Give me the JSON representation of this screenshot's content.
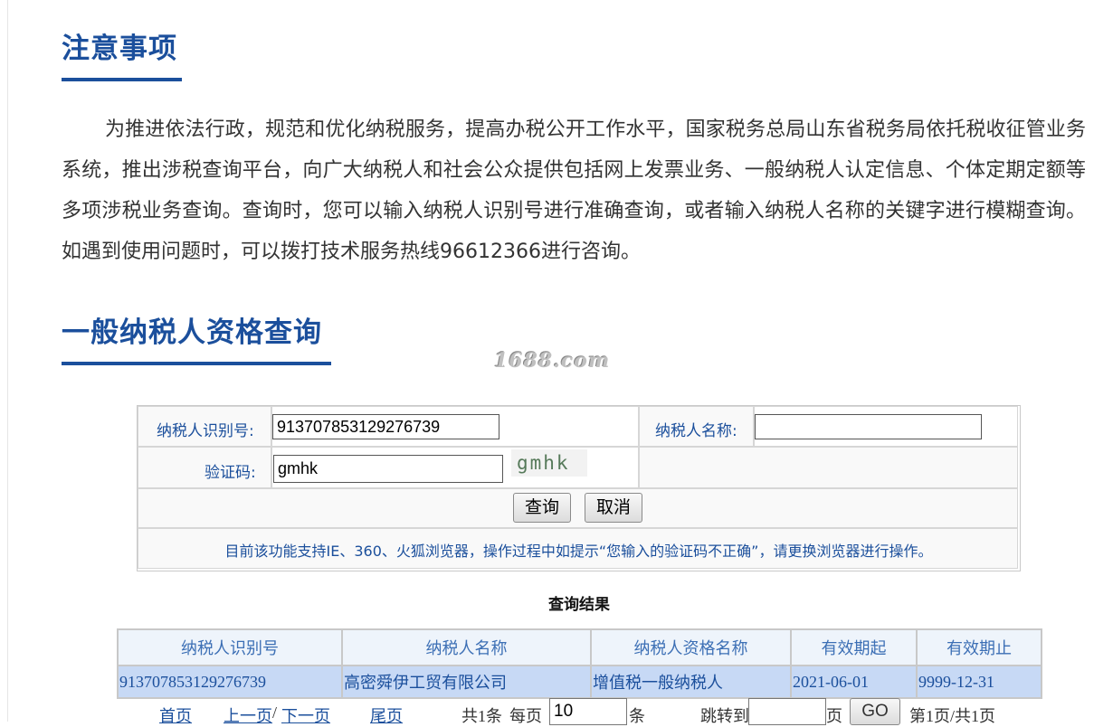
{
  "notice": {
    "title": "注意事项",
    "body": "为推进依法行政，规范和优化纳税服务，提高办税公开工作水平，国家税务总局山东省税务局依托税收征管业务系统，推出涉税查询平台，向广大纳税人和社会公众提供包括网上发票业务、一般纳税人认定信息、个体定期定额等多项涉税业务查询。查询时，您可以输入纳税人识别号进行准确查询，或者输入纳税人名称的关键字进行模糊查询。如遇到使用问题时，可以拨打技术服务热线96612366进行咨询。"
  },
  "query": {
    "title": "一般纳税人资格查询",
    "watermark": "1688.com",
    "taxpayer_id_label": "纳税人识别号:",
    "taxpayer_id_value": "913707853129276739",
    "taxpayer_name_label": "纳税人名称:",
    "taxpayer_name_value": "",
    "captcha_label": "验证码:",
    "captcha_value": "gmhk",
    "captcha_image_text": "gmhk",
    "query_button": "查询",
    "cancel_button": "取消",
    "hint": "目前该功能支持IE、360、火狐浏览器，操作过程中如提示“您输入的验证码不正确”，请更换浏览器进行操作。"
  },
  "results": {
    "title": "查询结果",
    "columns": [
      "纳税人识别号",
      "纳税人名称",
      "纳税人资格名称",
      "有效期起",
      "有效期止"
    ],
    "rows": [
      [
        "913707853129276739",
        "高密舜伊工贸有限公司",
        "增值税一般纳税人",
        "2021-06-01",
        "9999-12-31"
      ]
    ]
  },
  "pager": {
    "first": "首页",
    "prev": "上一页",
    "separator": "/",
    "next": "下一页",
    "last": "尾页",
    "total": "共1条",
    "per_page_label": "每页",
    "per_page_value": "10",
    "per_page_unit": "条",
    "jump_label": "跳转到",
    "jump_value": "",
    "page_unit": "页",
    "go_button": "GO",
    "status": "第1页/共1页"
  },
  "colors": {
    "accent": "#1b4f9c",
    "row_highlight": "#c7d9f5",
    "header_bg": "#eef4fb"
  }
}
